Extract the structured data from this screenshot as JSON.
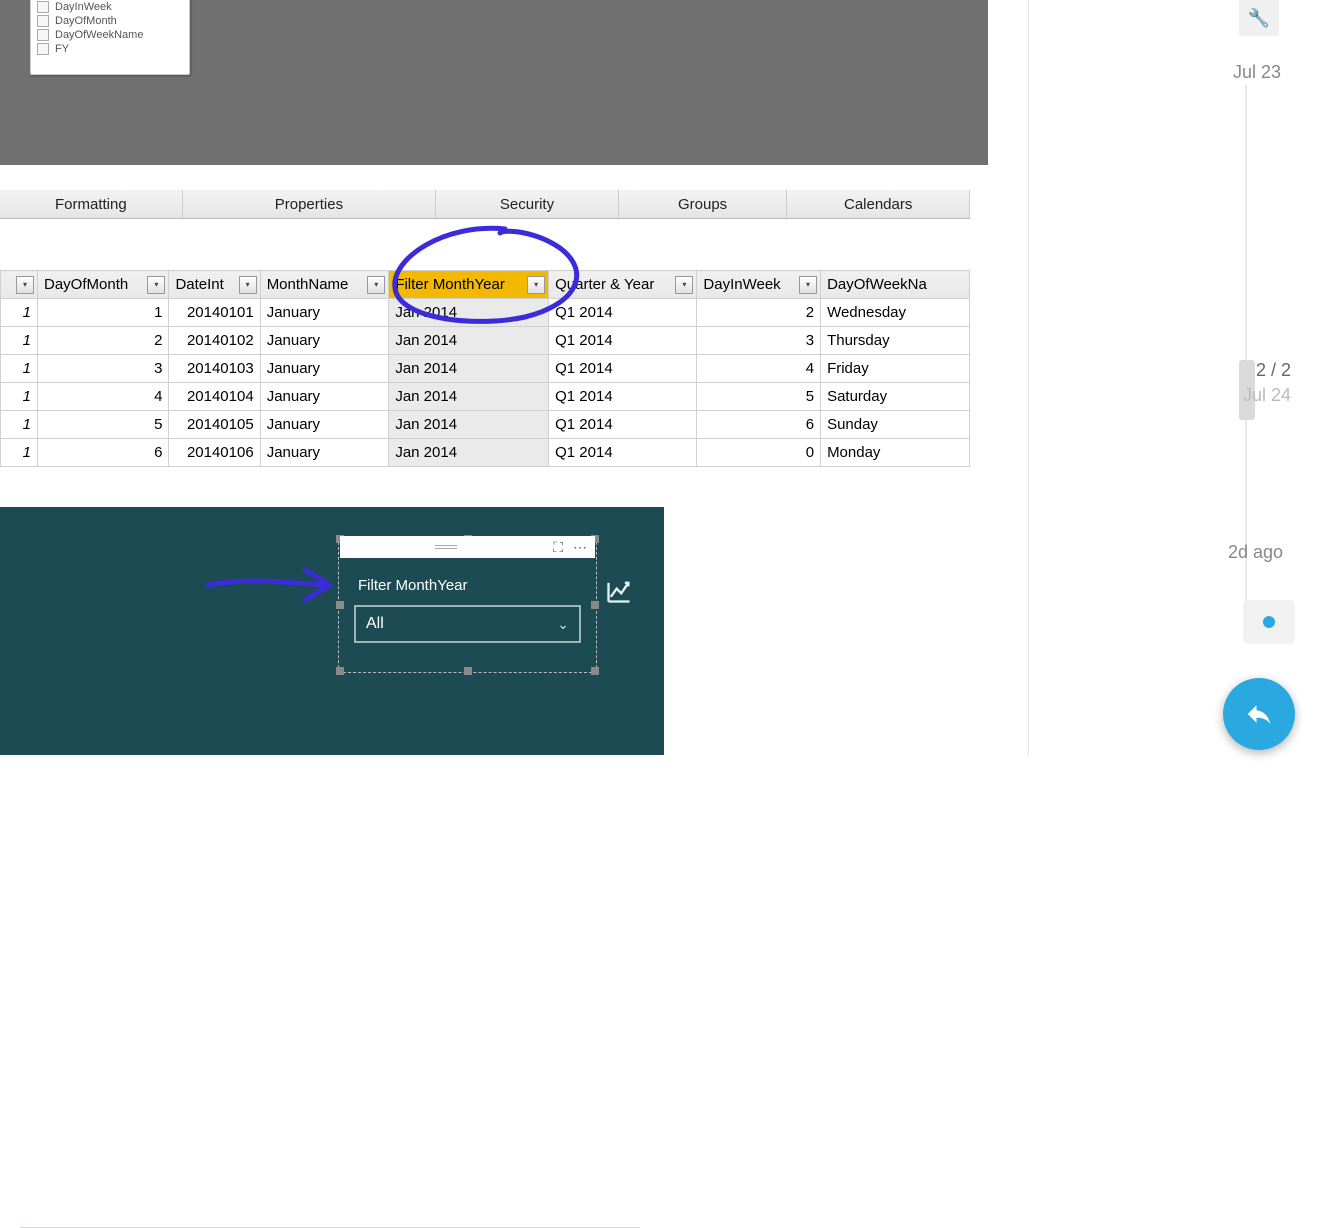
{
  "fields_panel": {
    "items": [
      "DayInWeek",
      "DayOfMonth",
      "DayOfWeekName",
      "FY"
    ]
  },
  "tabs": {
    "formatting": "Formatting",
    "properties": "Properties",
    "security": "Security",
    "groups": "Groups",
    "calendars": "Calendars"
  },
  "grid": {
    "headers": {
      "idx": "",
      "dayofmonth": "DayOfMonth",
      "dateint": "DateInt",
      "monthname": "MonthName",
      "filtermy": "Filter MonthYear",
      "qy": "Quarter & Year",
      "dayinweek": "DayInWeek",
      "downame": "DayOfWeekNa"
    },
    "rows": [
      {
        "idx": "1",
        "dayofmonth": "1",
        "dateint": "20140101",
        "monthname": "January",
        "filtermy": "Jan 2014",
        "qy": "Q1 2014",
        "dayinweek": "2",
        "downame": "Wednesday"
      },
      {
        "idx": "1",
        "dayofmonth": "2",
        "dateint": "20140102",
        "monthname": "January",
        "filtermy": "Jan 2014",
        "qy": "Q1 2014",
        "dayinweek": "3",
        "downame": "Thursday"
      },
      {
        "idx": "1",
        "dayofmonth": "3",
        "dateint": "20140103",
        "monthname": "January",
        "filtermy": "Jan 2014",
        "qy": "Q1 2014",
        "dayinweek": "4",
        "downame": "Friday"
      },
      {
        "idx": "1",
        "dayofmonth": "4",
        "dateint": "20140104",
        "monthname": "January",
        "filtermy": "Jan 2014",
        "qy": "Q1 2014",
        "dayinweek": "5",
        "downame": "Saturday"
      },
      {
        "idx": "1",
        "dayofmonth": "5",
        "dateint": "20140105",
        "monthname": "January",
        "filtermy": "Jan 2014",
        "qy": "Q1 2014",
        "dayinweek": "6",
        "downame": "Sunday"
      },
      {
        "idx": "1",
        "dayofmonth": "6",
        "dateint": "20140106",
        "monthname": "January",
        "filtermy": "Jan 2014",
        "qy": "Q1 2014",
        "dayinweek": "0",
        "downame": "Monday"
      }
    ]
  },
  "slicer": {
    "title": "Filter MonthYear",
    "value": "All"
  },
  "timeline": {
    "top_date": "Jul 23",
    "progress_count": "2 / 2",
    "progress_date": "Jul 24",
    "bottom_label": "2d ago"
  }
}
